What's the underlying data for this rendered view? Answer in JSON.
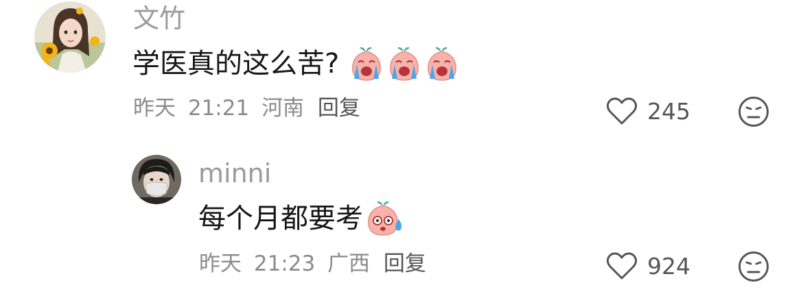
{
  "comment": {
    "username": "文竹",
    "text": "学医真的这么苦?",
    "emojis": [
      "crying-peach-emoji",
      "crying-peach-emoji",
      "crying-peach-emoji"
    ],
    "date": "昨天",
    "time": "21:21",
    "location": "河南",
    "reply_label": "回复",
    "likes": "245",
    "icons": {
      "like": "heart-outline-icon",
      "dislike": "meh-face-icon"
    }
  },
  "reply": {
    "username": "minni",
    "text": "每个月都要考",
    "emojis": [
      "nervous-sweat-peach-emoji"
    ],
    "date": "昨天",
    "time": "21:23",
    "location": "广西",
    "reply_label": "回复",
    "likes": "924",
    "icons": {
      "like": "heart-outline-icon",
      "dislike": "meh-face-icon"
    }
  },
  "colors": {
    "username": "#9a9a9a",
    "text": "#161616",
    "meta": "#8a8a8a",
    "icon": "#555555"
  }
}
